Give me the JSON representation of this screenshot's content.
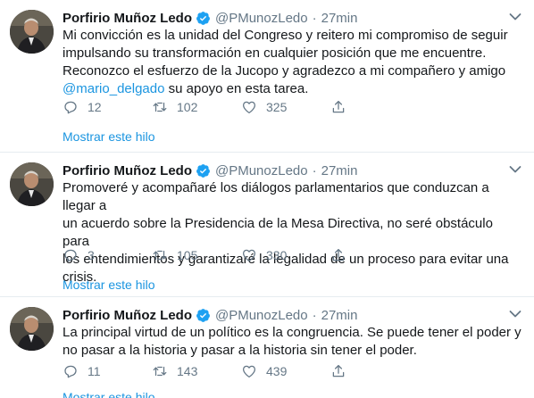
{
  "tweets": [
    {
      "author_name": "Porfirio Muñoz Ledo",
      "handle": "@PMunozLedo",
      "separator": "·",
      "time": "27min",
      "text_lines": [
        "Mi convicción es la unidad del Congreso y reitero mi compromiso de seguir",
        "impulsando su transformación en cualquier posición que me encuentre.",
        "Reconozco el esfuerzo de la Jucopo y agradezco a mi compañero y amigo"
      ],
      "mention": "@mario_delgado",
      "text_tail": " su apoyo en esta tarea.",
      "replies": "12",
      "retweets": "102",
      "likes": "325",
      "show_thread": "Mostrar este hilo"
    },
    {
      "author_name": "Porfirio Muñoz Ledo",
      "handle": "@PMunozLedo",
      "separator": "·",
      "time": "27min",
      "text_lines": [
        "Promoveré y acompañaré los diálogos parlamentarios que conduzcan a llegar a",
        "un acuerdo sobre la Presidencia de la Mesa Directiva, no seré obstáculo para",
        "los entendimientos y garantizaré la legalidad de un proceso para evitar una",
        "crisis."
      ],
      "replies": "3",
      "retweets": "105",
      "likes": "330",
      "show_thread": "Mostrar este hilo"
    },
    {
      "author_name": "Porfirio Muñoz Ledo",
      "handle": "@PMunozLedo",
      "separator": "·",
      "time": "27min",
      "text_lines": [
        "La principal virtud de un político es la congruencia. Se puede tener el poder y",
        "no pasar a la historia y pasar a la historia sin tener el poder."
      ],
      "replies": "11",
      "retweets": "143",
      "likes": "439",
      "show_thread": "Mostrar este hilo"
    }
  ],
  "icons": {
    "verified": "verified-badge-icon",
    "reply": "reply-icon",
    "retweet": "retweet-icon",
    "like": "heart-icon",
    "share": "share-icon",
    "menu": "chevron-down-icon",
    "avatar": "profile-photo"
  },
  "colors": {
    "link": "#1b95e0",
    "verified": "#1da1f2",
    "muted": "#657786",
    "divider": "#e6ecf0"
  }
}
